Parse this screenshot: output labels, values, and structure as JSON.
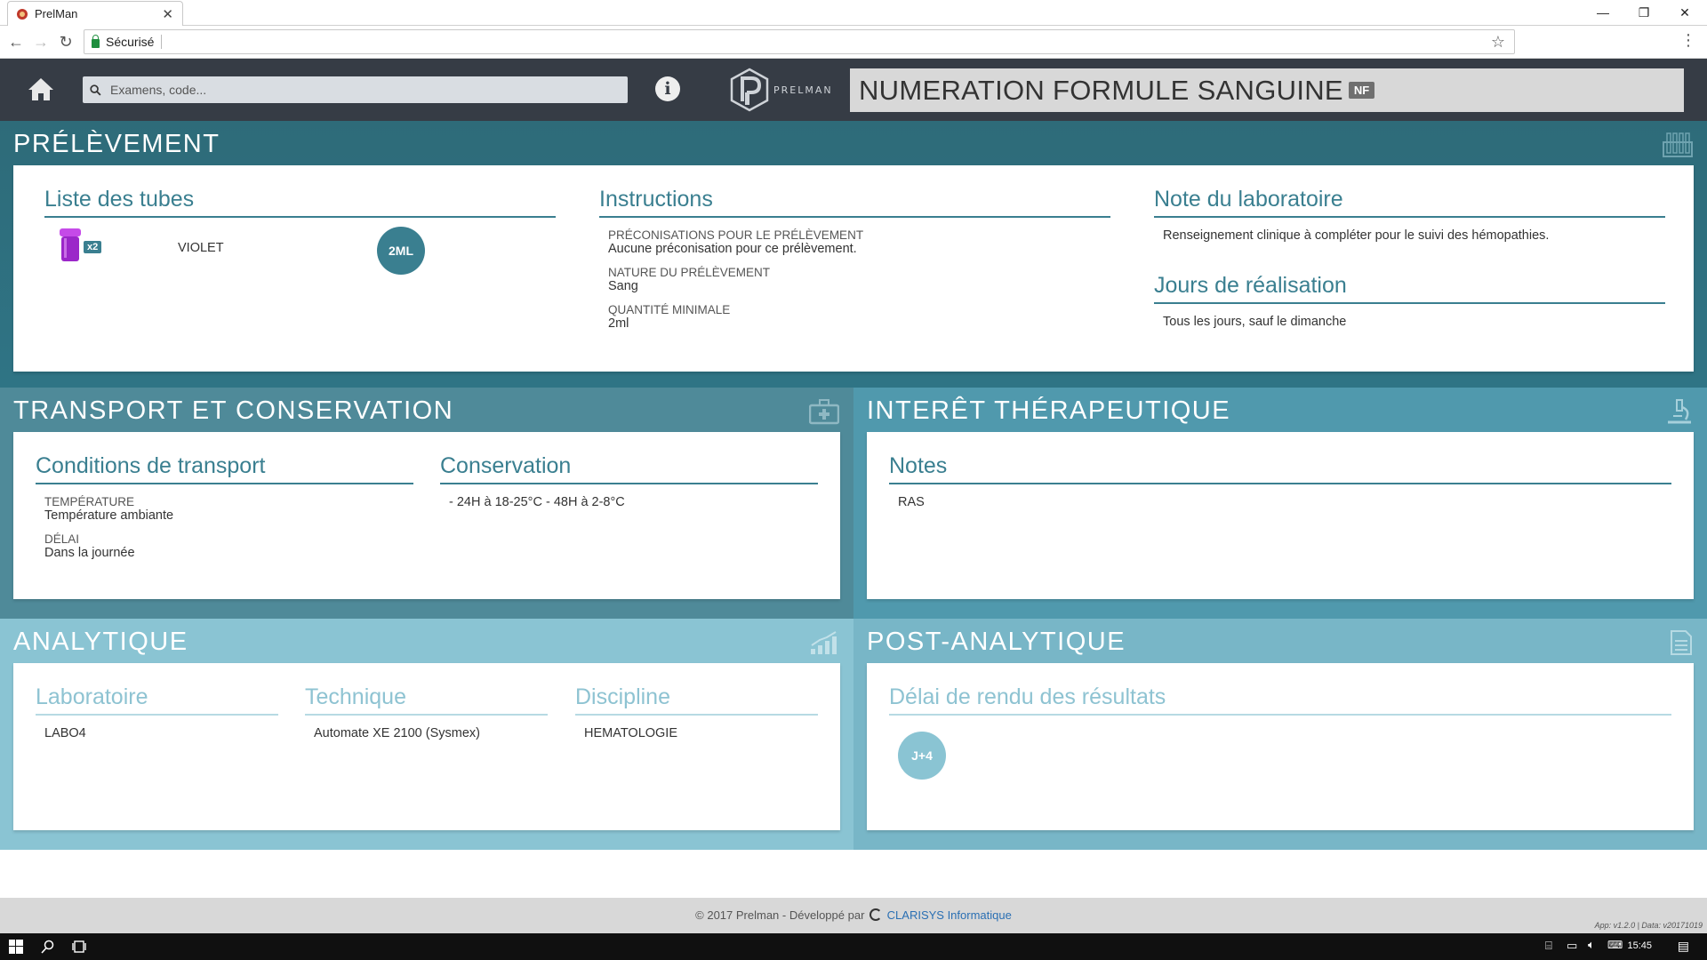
{
  "browser": {
    "tab_title": "PrelMan",
    "secure_label": "Sécurisé",
    "url": ""
  },
  "header": {
    "search_placeholder": "Examens, code...",
    "logo_text": "PRELMAN",
    "exam_title": "NUMERATION FORMULE SANGUINE",
    "exam_code": "NF"
  },
  "prelevement": {
    "title": "PRÉLÈVEMENT",
    "tubes": {
      "heading": "Liste des tubes",
      "count": "x2",
      "color_name": "VIOLET",
      "volume": "2ML",
      "tube_color": "#9b27c9"
    },
    "instructions": {
      "heading": "Instructions",
      "preco_label": "PRÉCONISATIONS POUR LE PRÉLÈVEMENT",
      "preco_value": "Aucune préconisation pour ce prélèvement.",
      "nature_label": "NATURE DU PRÉLÈVEMENT",
      "nature_value": "Sang",
      "qty_label": "QUANTITÉ MINIMALE",
      "qty_value": "2ml"
    },
    "note": {
      "heading": "Note du laboratoire",
      "value": "Renseignement clinique à compléter pour le suivi des hémopathies."
    },
    "days": {
      "heading": "Jours de réalisation",
      "value": "Tous les jours, sauf le dimanche"
    }
  },
  "transport": {
    "title": "TRANSPORT ET CONSERVATION",
    "conditions_heading": "Conditions de transport",
    "temp_label": "TEMPÉRATURE",
    "temp_value": "Température ambiante",
    "delay_label": "DÉLAI",
    "delay_value": "Dans la journée",
    "conservation_heading": "Conservation",
    "conservation_value": "- 24H à 18-25°C - 48H à 2-8°C"
  },
  "interet": {
    "title": "INTERÊT THÉRAPEUTIQUE",
    "notes_heading": "Notes",
    "notes_value": "RAS"
  },
  "analytique": {
    "title": "ANALYTIQUE",
    "lab_heading": "Laboratoire",
    "lab_value": "LABO4",
    "tech_heading": "Technique",
    "tech_value": "Automate XE 2100 (Sysmex)",
    "disc_heading": "Discipline",
    "disc_value": "HEMATOLOGIE"
  },
  "post": {
    "title": "POST-ANALYTIQUE",
    "delay_heading": "Délai de rendu des résultats",
    "delay_value": "J+4"
  },
  "footer": {
    "text": "© 2017 Prelman - Développé par",
    "company": "CLARISYS Informatique",
    "version": "App: v1.2.0 | Data: v20171019"
  },
  "taskbar": {
    "time": "15:45"
  },
  "colors": {
    "dark_header": "#363c45",
    "prelevement_bg": "#2e6b79",
    "transport_bg": "#4f8a99",
    "interet_bg": "#5099ad",
    "analytique_bg": "#8ac4d3",
    "post_bg": "#78b6c7",
    "accent": "#3a7f90"
  }
}
